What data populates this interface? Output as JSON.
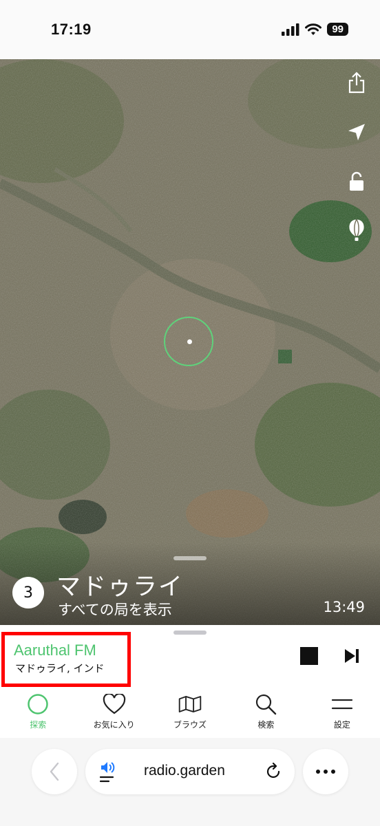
{
  "status_bar": {
    "time": "17:19",
    "battery": "99"
  },
  "map": {
    "buttons": [
      {
        "name": "share-icon"
      },
      {
        "name": "location-arrow-icon"
      },
      {
        "name": "unlock-icon"
      },
      {
        "name": "balloon-icon"
      }
    ],
    "place": {
      "count": "3",
      "title": "マドゥライ",
      "subtitle": "すべての局を表示",
      "local_time": "13:49"
    }
  },
  "player": {
    "station_name": "Aaruthal FM",
    "station_location": "マドゥライ, インド"
  },
  "tabs": [
    {
      "label": "探索",
      "icon": "circle-icon",
      "active": true
    },
    {
      "label": "お気に入り",
      "icon": "heart-icon",
      "active": false
    },
    {
      "label": "ブラウズ",
      "icon": "map-icon",
      "active": false
    },
    {
      "label": "検索",
      "icon": "search-icon",
      "active": false
    },
    {
      "label": "設定",
      "icon": "menu-icon",
      "active": false
    }
  ],
  "browser": {
    "url": "radio.garden"
  },
  "colors": {
    "accent": "#4ec46f",
    "highlight": "#ff0000"
  }
}
